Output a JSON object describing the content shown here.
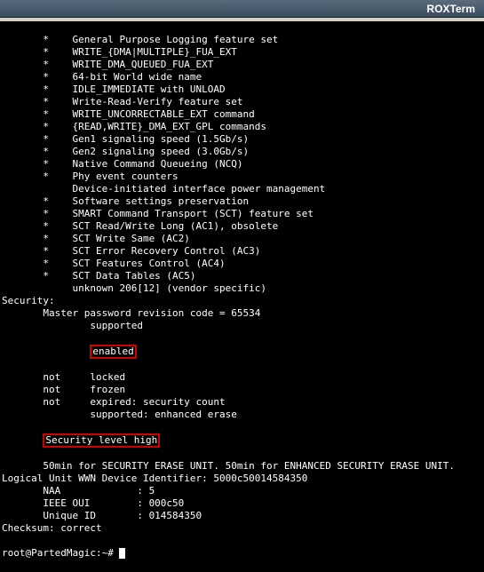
{
  "window": {
    "title": "ROXTerm"
  },
  "highlight": {
    "enabled": "enabled",
    "level": "Security level high"
  },
  "prompt": "root@PartedMagic:~# ",
  "lines": [
    "       *    General Purpose Logging feature set",
    "       *    WRITE_{DMA|MULTIPLE}_FUA_EXT",
    "       *    WRITE_DMA_QUEUED_FUA_EXT",
    "       *    64-bit World wide name",
    "       *    IDLE_IMMEDIATE with UNLOAD",
    "       *    Write-Read-Verify feature set",
    "       *    WRITE_UNCORRECTABLE_EXT command",
    "       *    {READ,WRITE}_DMA_EXT_GPL commands",
    "       *    Gen1 signaling speed (1.5Gb/s)",
    "       *    Gen2 signaling speed (3.0Gb/s)",
    "       *    Native Command Queueing (NCQ)",
    "       *    Phy event counters",
    "            Device-initiated interface power management",
    "       *    Software settings preservation",
    "       *    SMART Command Transport (SCT) feature set",
    "       *    SCT Read/Write Long (AC1), obsolete",
    "       *    SCT Write Same (AC2)",
    "       *    SCT Error Recovery Control (AC3)",
    "       *    SCT Features Control (AC4)",
    "       *    SCT Data Tables (AC5)",
    "            unknown 206[12] (vendor specific)",
    "Security:",
    "       Master password revision code = 65534",
    "               supported"
  ],
  "after_enabled": [
    "       not     locked",
    "       not     frozen",
    "       not     expired: security count",
    "               supported: enhanced erase"
  ],
  "after_level": [
    "       50min for SECURITY ERASE UNIT. 50min for ENHANCED SECURITY ERASE UNIT.",
    "Logical Unit WWN Device Identifier: 5000c50014584350",
    "       NAA             : 5",
    "       IEEE OUI        : 000c50",
    "       Unique ID       : 014584350",
    "Checksum: correct"
  ],
  "enabled_prefix": "               ",
  "level_prefix": "       "
}
